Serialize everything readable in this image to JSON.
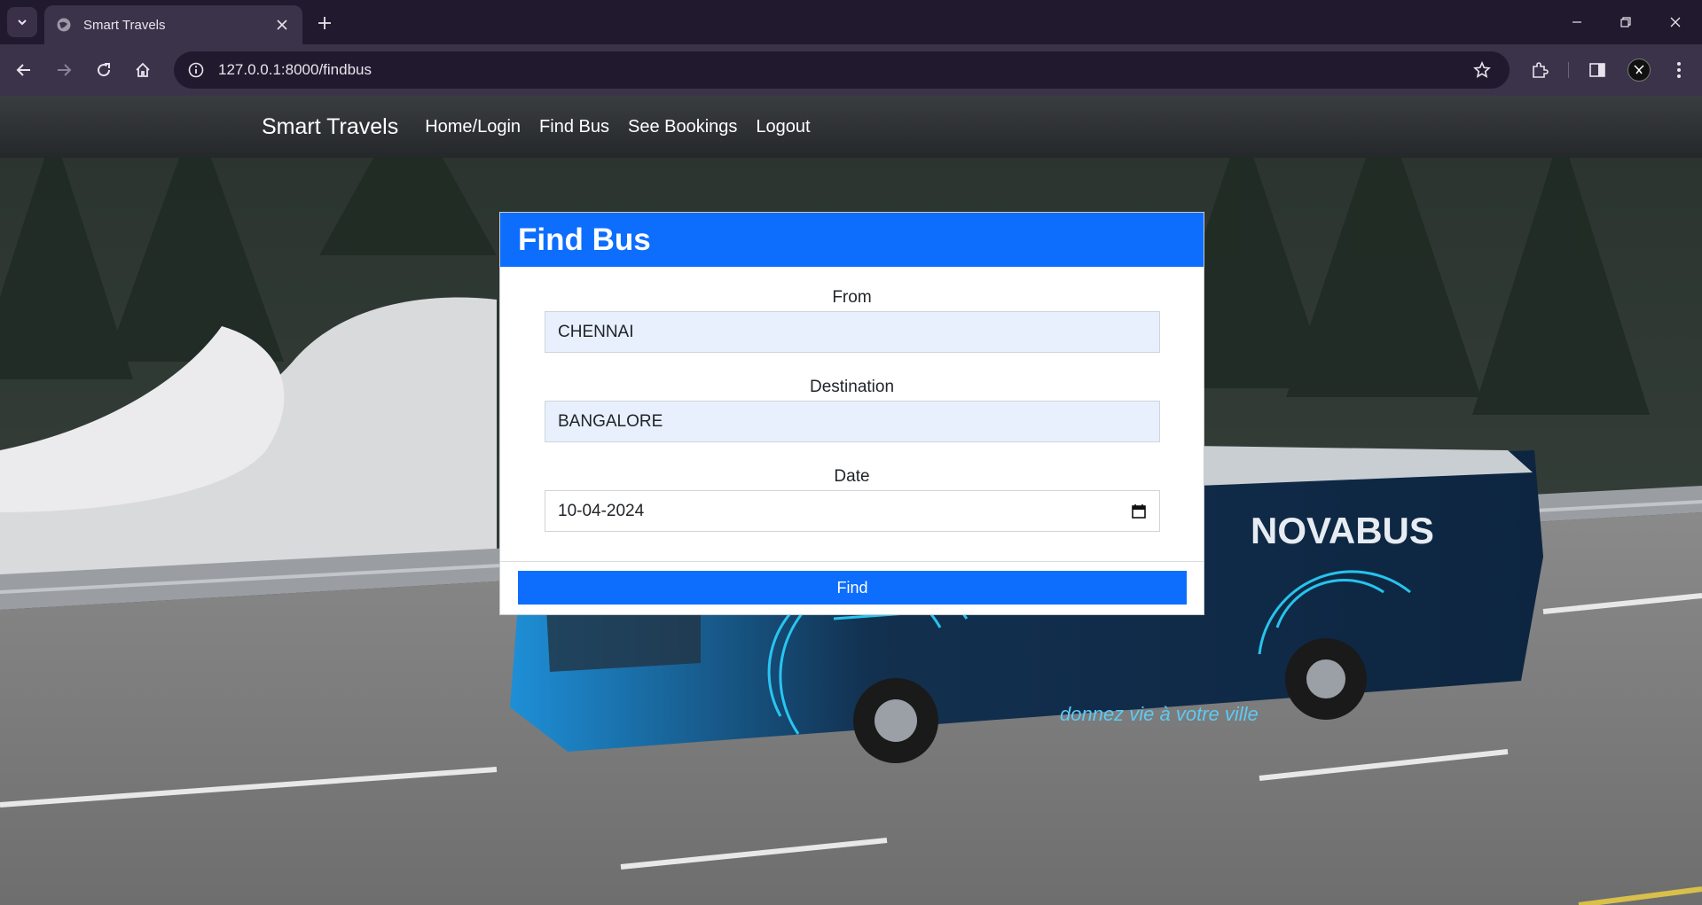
{
  "browser": {
    "tab_title": "Smart Travels",
    "url": "127.0.0.1:8000/findbus"
  },
  "navbar": {
    "brand": "Smart Travels",
    "links": [
      "Home/Login",
      "Find Bus",
      "See Bookings",
      "Logout"
    ]
  },
  "form": {
    "title": "Find Bus",
    "from_label": "From",
    "from_value": "CHENNAI",
    "destination_label": "Destination",
    "destination_value": "BANGALORE",
    "date_label": "Date",
    "date_value": "10-04-2024",
    "submit_label": "Find"
  },
  "background": {
    "bus_brand": "NOVABUS",
    "bus_slogan": "donnez vie à votre ville"
  },
  "colors": {
    "primary": "#0d6efd",
    "chrome_dark": "#211a2e",
    "chrome_mid": "#3b3349"
  }
}
